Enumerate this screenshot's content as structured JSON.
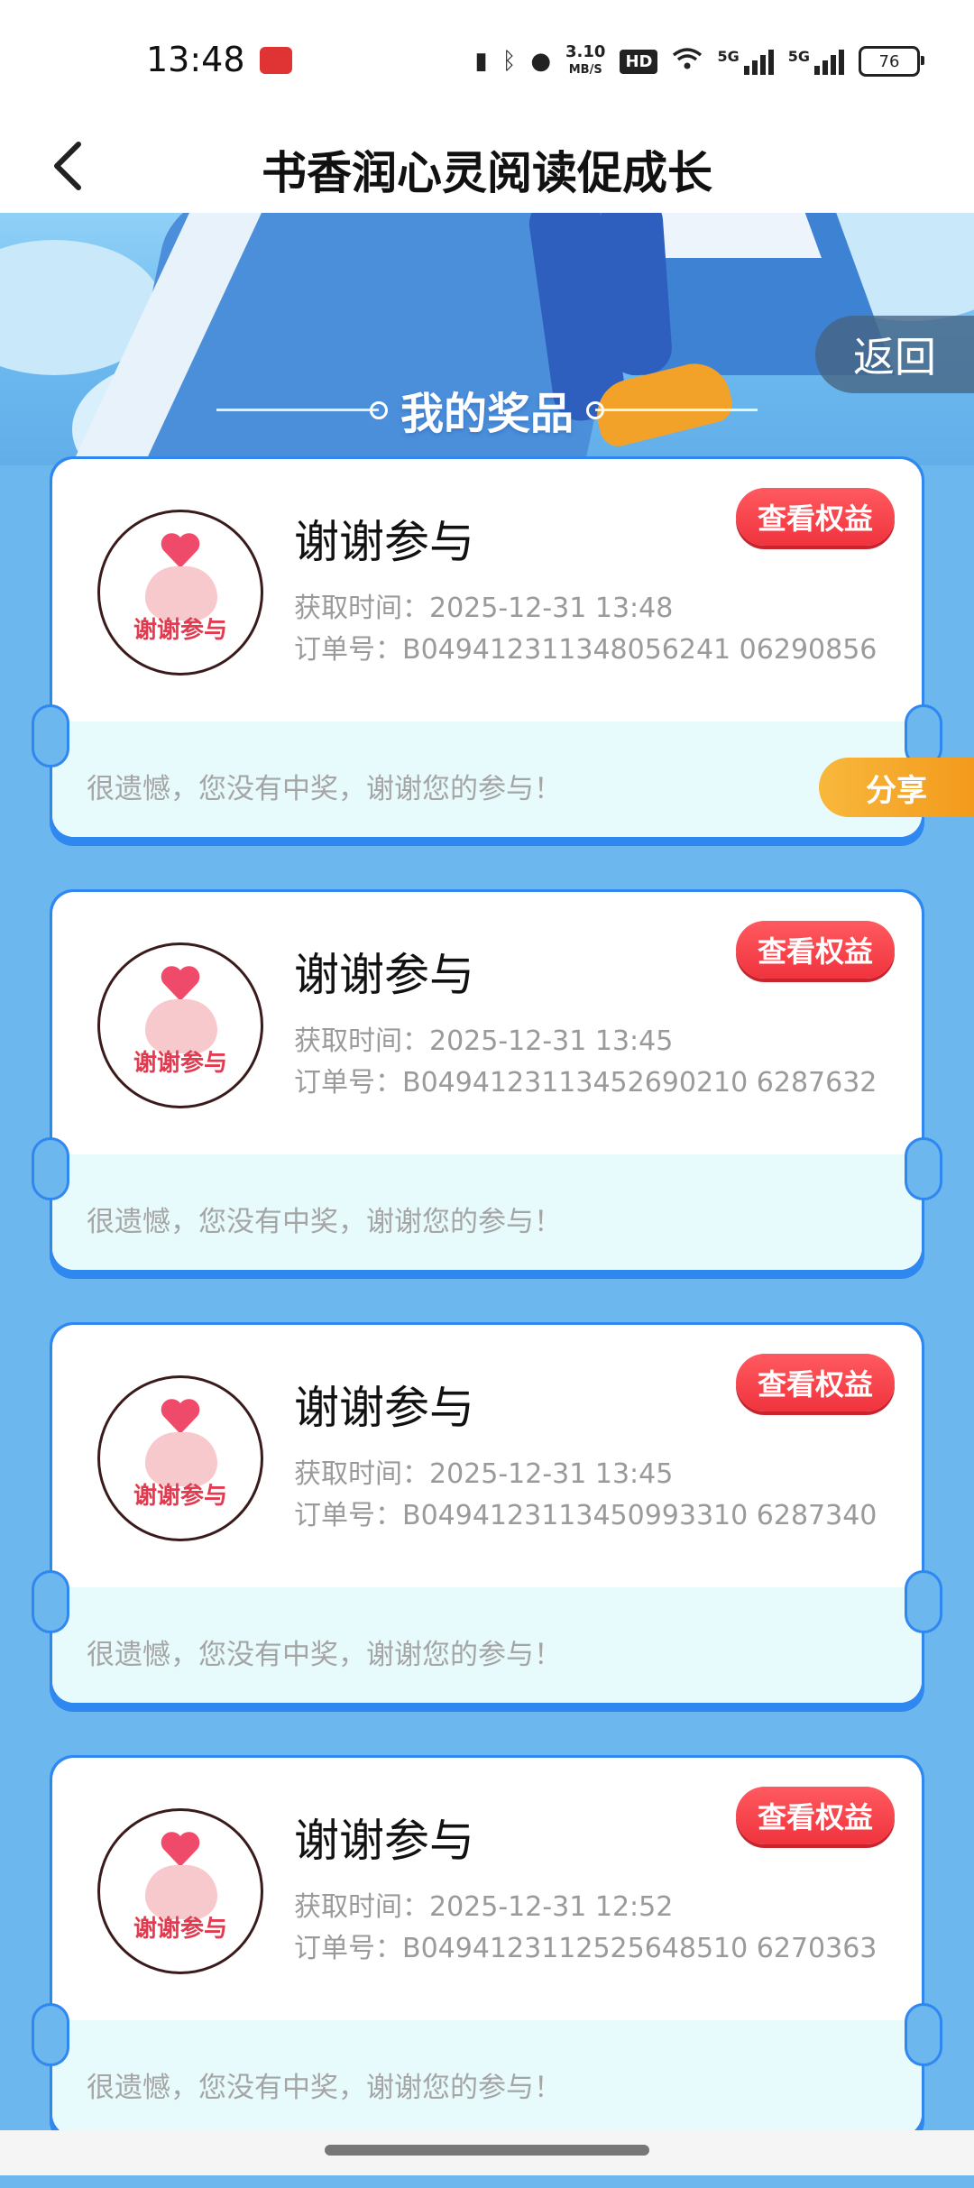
{
  "status_bar": {
    "time": "13:48",
    "net_speed_value": "3.10",
    "net_speed_unit": "MB/S",
    "hd_label": "HD",
    "network_1": "5G",
    "network_2": "5G",
    "battery": "76"
  },
  "header": {
    "title": "书香润心灵阅读促成长"
  },
  "banner": {
    "title": "我的奖品",
    "return_label": "返回",
    "share_label": "分享"
  },
  "prizes": [
    {
      "name": "谢谢参与",
      "image_label": "谢谢参与",
      "time": "获取时间：2025-12-31 13:48",
      "order": "订单号：B049412311348056241 06290856",
      "button": "查看权益",
      "message": "很遗憾，您没有中奖，谢谢您的参与！"
    },
    {
      "name": "谢谢参与",
      "image_label": "谢谢参与",
      "time": "获取时间：2025-12-31 13:45",
      "order": "订单号：B0494123113452690210 6287632",
      "button": "查看权益",
      "message": "很遗憾，您没有中奖，谢谢您的参与！"
    },
    {
      "name": "谢谢参与",
      "image_label": "谢谢参与",
      "time": "获取时间：2025-12-31 13:45",
      "order": "订单号：B0494123113450993310 6287340",
      "button": "查看权益",
      "message": "很遗憾，您没有中奖，谢谢您的参与！"
    },
    {
      "name": "谢谢参与",
      "image_label": "谢谢参与",
      "time": "获取时间：2025-12-31 12:52",
      "order": "订单号：B0494123112525648510 6270363",
      "button": "查看权益",
      "message": "很遗憾，您没有中奖，谢谢您的参与！"
    }
  ],
  "colors": {
    "accent_red": "#f0333d",
    "share_orange": "#f39a1c",
    "card_border": "#2f87f0",
    "page_bg": "#6db7ef"
  }
}
